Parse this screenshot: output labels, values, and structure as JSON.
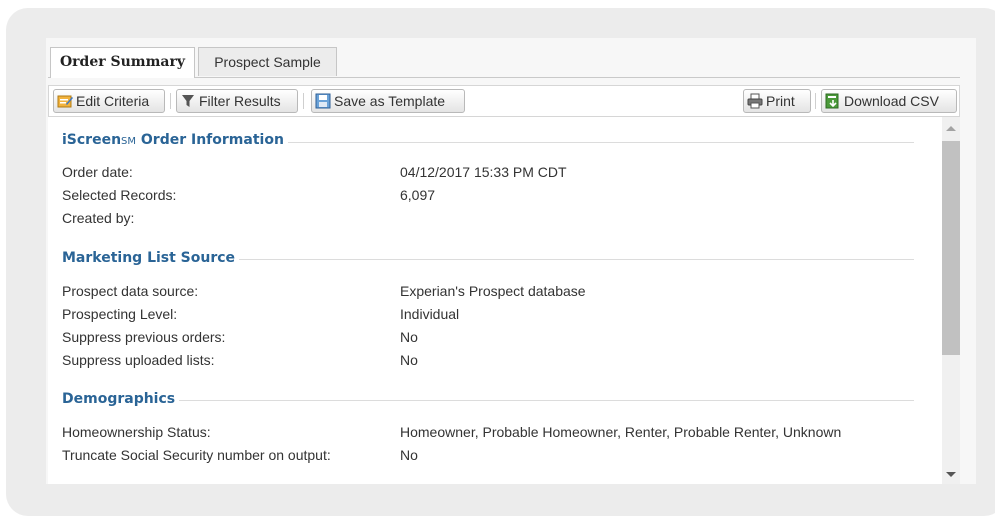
{
  "tabs": [
    {
      "label": "Order Summary",
      "active": true
    },
    {
      "label": "Prospect Sample",
      "active": false
    }
  ],
  "toolbar": {
    "edit_criteria": "Edit Criteria",
    "filter_results": "Filter Results",
    "save_template": "Save as Template",
    "print": "Print",
    "download_csv": "Download CSV"
  },
  "sections": [
    {
      "title": "iScreen",
      "title_mark": "SM",
      "title_suffix": " Order Information",
      "rows": [
        {
          "label": "Order date:",
          "value": "04/12/2017 15:33 PM CDT"
        },
        {
          "label": "Selected Records:",
          "value": "6,097"
        },
        {
          "label": "Created by:",
          "value": ""
        }
      ]
    },
    {
      "title": "Marketing List Source",
      "rows": [
        {
          "label": "Prospect data source:",
          "value": "Experian's Prospect database"
        },
        {
          "label": "Prospecting Level:",
          "value": "Individual"
        },
        {
          "label": "Suppress previous orders:",
          "value": "No"
        },
        {
          "label": "Suppress uploaded lists:",
          "value": "No"
        }
      ]
    },
    {
      "title": "Demographics",
      "rows": [
        {
          "label": "Homeownership Status:",
          "value": "Homeowner, Probable Homeowner, Renter, Probable Renter, Unknown"
        },
        {
          "label": "Truncate Social Security number on output:",
          "value": "No"
        }
      ]
    }
  ],
  "colors": {
    "section_title": "#2a6496",
    "card_background": "#ececec"
  },
  "icons": [
    "edit-criteria-icon",
    "filter-icon",
    "save-template-icon",
    "print-icon",
    "download-csv-icon",
    "scroll-up-icon",
    "scroll-down-icon"
  ]
}
